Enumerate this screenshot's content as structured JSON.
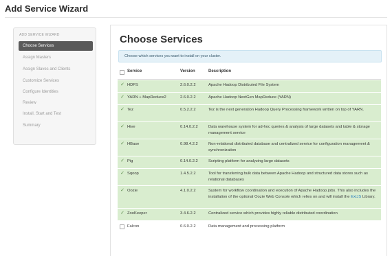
{
  "page": {
    "title": "Add Service Wizard"
  },
  "sidebar": {
    "heading": "ADD SERVICE WIZARD",
    "steps": [
      {
        "label": "Choose Services",
        "active": true
      },
      {
        "label": "Assign Masters",
        "active": false
      },
      {
        "label": "Assign Slaves and Clients",
        "active": false
      },
      {
        "label": "Customize Services",
        "active": false
      },
      {
        "label": "Configure Identities",
        "active": false
      },
      {
        "label": "Review",
        "active": false
      },
      {
        "label": "Install, Start and Test",
        "active": false
      },
      {
        "label": "Summary",
        "active": false
      }
    ]
  },
  "main": {
    "title": "Choose Services",
    "info": "Choose which services you want to install on your cluster."
  },
  "table": {
    "columns": {
      "service": "Service",
      "version": "Version",
      "description": "Description"
    },
    "check_glyph": "✓",
    "rows": [
      {
        "service": "HDFS",
        "version": "2.6.0.2.2",
        "description": "Apache Hadoop Distributed File System",
        "checked": true
      },
      {
        "service": "YARN + MapReduce2",
        "version": "2.6.0.2.2",
        "description": "Apache Hadoop NextGen MapReduce (YARN)",
        "checked": true
      },
      {
        "service": "Tez",
        "version": "0.5.2.2.2",
        "description": "Tez is the next generation Hadoop Query Processing framework written on top of YARN.",
        "checked": true
      },
      {
        "service": "Hive",
        "version": "0.14.0.2.2",
        "description": "Data warehouse system for ad-hoc queries & analysis of large datasets and table & storage management service",
        "checked": true
      },
      {
        "service": "HBase",
        "version": "0.98.4.2.2",
        "description": "Non-relational distributed database and centralized service for configuration management & synchronization",
        "checked": true
      },
      {
        "service": "Pig",
        "version": "0.14.0.2.2",
        "description": "Scripting platform for analyzing large datasets",
        "checked": true
      },
      {
        "service": "Sqoop",
        "version": "1.4.5.2.2",
        "description": "Tool for transferring bulk data between Apache Hadoop and structured data stores such as relational databases",
        "checked": true
      },
      {
        "service": "Oozie",
        "version": "4.1.0.2.2",
        "description_before_link": "System for workflow coordination and execution of Apache Hadoop jobs. This also includes the installation of the optional Oozie Web Console which relies on and will install the ",
        "link_text": "ExtJS",
        "description_after_link": " Library.",
        "checked": true
      },
      {
        "service": "ZooKeeper",
        "version": "3.4.6.2.2",
        "description": "Centralized service which provides highly reliable distributed coordination",
        "checked": true
      },
      {
        "service": "Falcon",
        "version": "0.6.0.2.2",
        "description": "Data management and processing platform",
        "checked": false
      }
    ]
  }
}
